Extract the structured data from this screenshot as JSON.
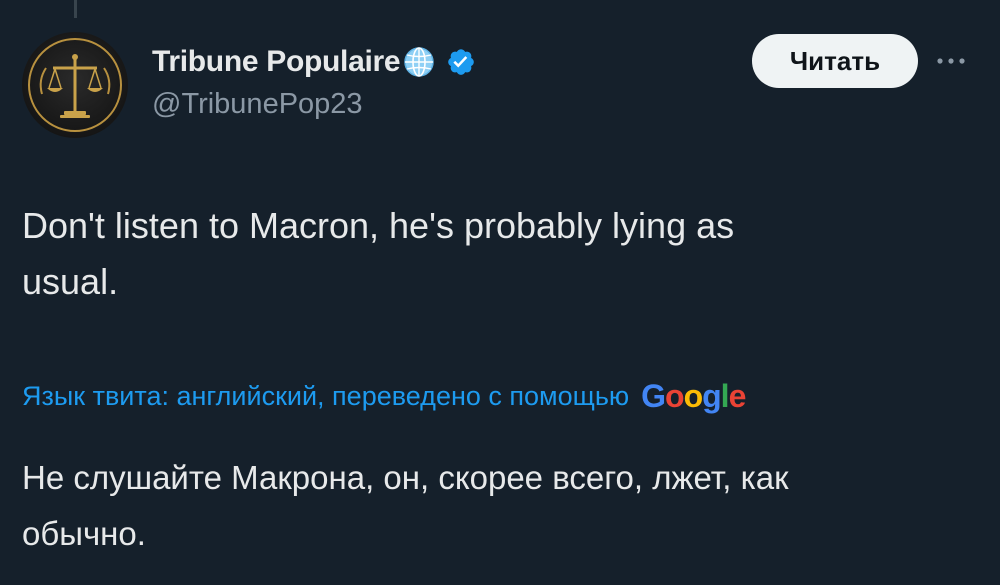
{
  "tweet": {
    "author": {
      "display_name": "Tribune Populaire",
      "handle": "@TribunePop23",
      "avatar_icon": "scales-of-justice-icon",
      "name_emoji_icon": "globe-icon",
      "verified_icon": "verified-badge-icon"
    },
    "follow_label": "Читать",
    "more_icon": "more-options-icon",
    "text_line_1": "Don't listen to Macron, he's probably lying as",
    "text_line_2": "usual.",
    "translation": {
      "note_label": "Язык твита: английский, переведено с помощью",
      "provider": "Google",
      "provider_letters": [
        "G",
        "o",
        "o",
        "g",
        "l",
        "e"
      ],
      "text_line_1": "Не слушайте Макрона, он, скорее всего, лжет, как",
      "text_line_2": "обычно."
    }
  },
  "colors": {
    "background": "#15202b",
    "primary_text": "#e7e9ea",
    "secondary_text": "#8b98a5",
    "link": "#1d9bf0",
    "follow_button_bg": "#eff3f4",
    "verified": "#1d9bf0"
  }
}
